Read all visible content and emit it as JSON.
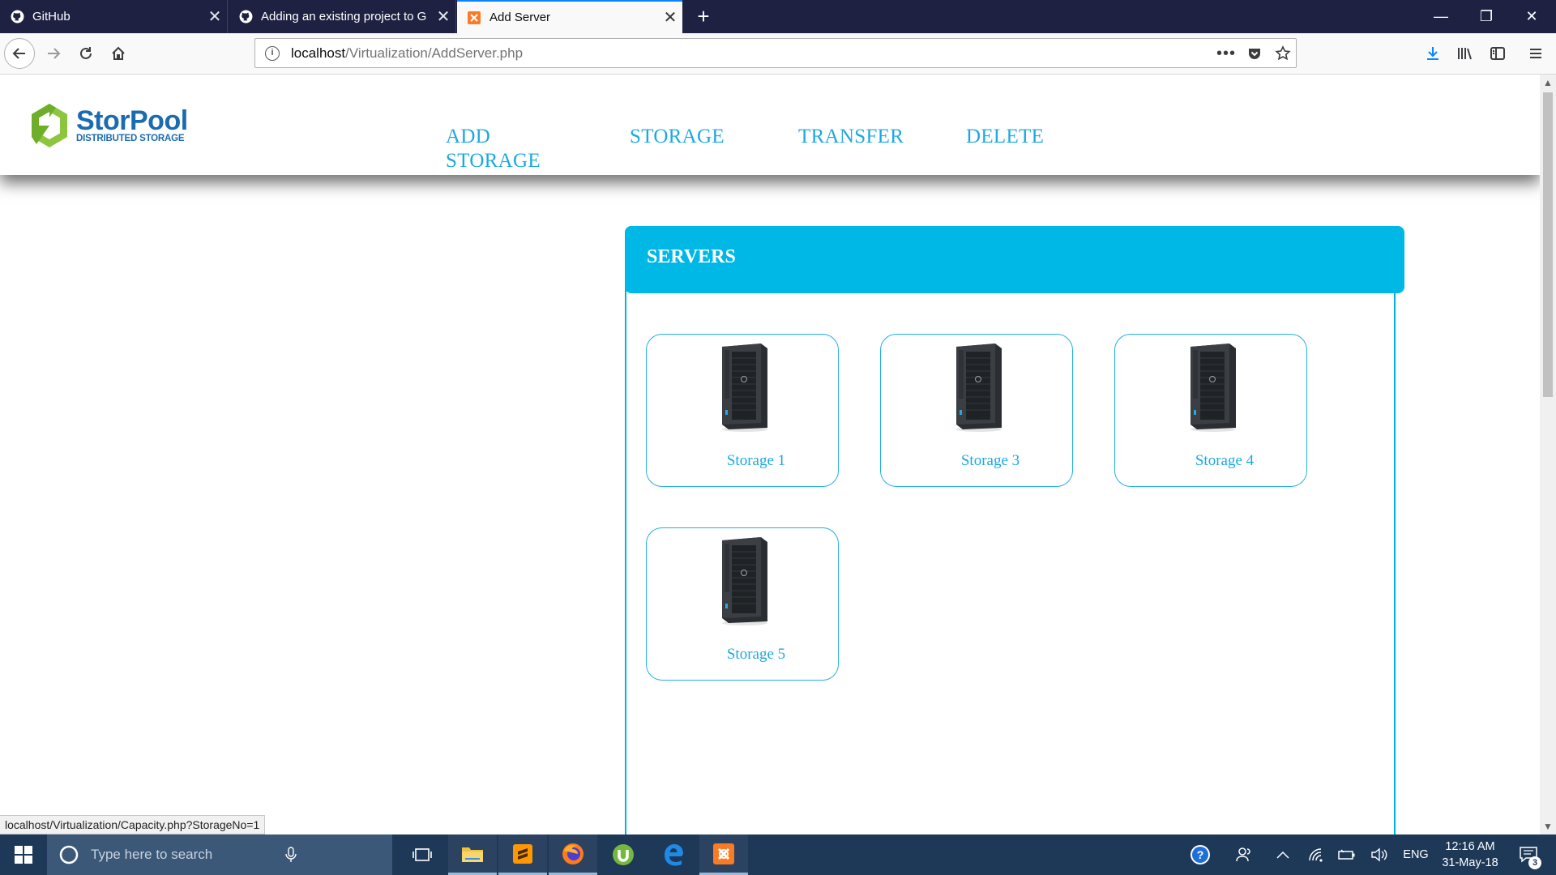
{
  "browser": {
    "tabs": [
      {
        "label": "GitHub",
        "icon": "github-icon",
        "active": false
      },
      {
        "label": "Adding an existing project to G",
        "icon": "github-icon",
        "active": false
      },
      {
        "label": "Add Server",
        "icon": "xampp-icon",
        "active": true
      }
    ],
    "url_host": "localhost",
    "url_path": "/Virtualization/AddServer.php",
    "status_link": "localhost/Virtualization/Capacity.php?StorageNo=1"
  },
  "site": {
    "logo_name": "StorPool",
    "logo_tagline": "DISTRIBUTED STORAGE",
    "menu": [
      {
        "label": "ADD STORAGE"
      },
      {
        "label": "STORAGE"
      },
      {
        "label": "TRANSFER"
      },
      {
        "label": "DELETE"
      }
    ]
  },
  "servers_panel": {
    "title": "SERVERS",
    "cards": [
      {
        "label": "Storage 1",
        "icon": "server-tower-icon"
      },
      {
        "label": "Storage 3",
        "icon": "server-tower-icon"
      },
      {
        "label": "Storage 4",
        "icon": "server-tower-icon"
      },
      {
        "label": "Storage 5",
        "icon": "server-tower-icon"
      }
    ]
  },
  "taskbar": {
    "search_placeholder": "Type here to search",
    "language": "ENG",
    "time": "12:16 AM",
    "date": "31-May-18",
    "notification_count": "3"
  },
  "colors": {
    "accent": "#00B8E6",
    "menu_text": "#1CA9E0",
    "logo_blue": "#1B6BB0",
    "logo_green": "#8CC63F",
    "tabbar_bg": "#1F2142",
    "taskbar_bg": "#1E3857"
  }
}
